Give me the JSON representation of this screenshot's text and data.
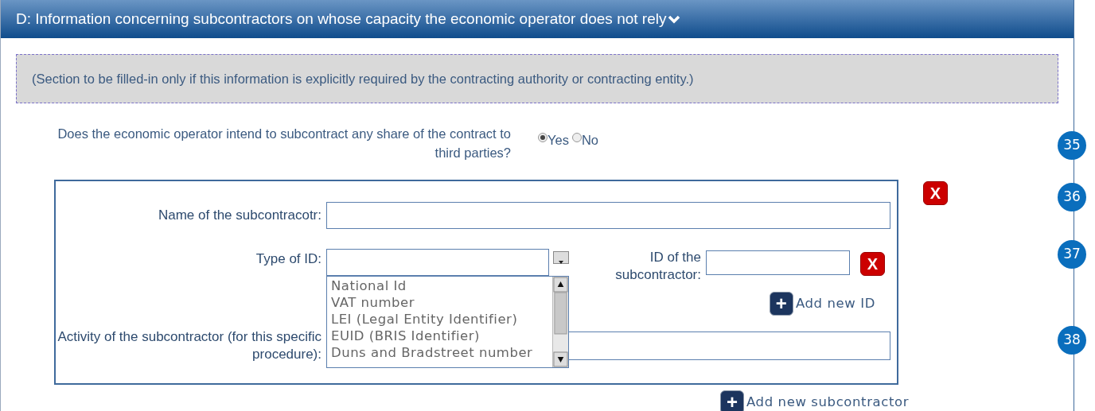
{
  "section": {
    "title": "D: Information concerning subcontractors on whose capacity the economic operator does not rely",
    "expanded": true
  },
  "notice": "(Section to be filled-in only if this information is explicitly required by the contracting authority or contracting entity.)",
  "question": {
    "label": "Does the economic operator intend to subcontract any share of the contract to third parties?",
    "options": [
      {
        "label": "Yes",
        "selected": true
      },
      {
        "label": "No",
        "selected": false
      }
    ]
  },
  "subcontractor": {
    "remove": "X",
    "name_label": "Name of the subcontracotr:",
    "type_label": "Type of ID:",
    "type_expanded": true,
    "type_options": [
      "National Id",
      "VAT number",
      "LEI (Legal Entity Identifier)",
      "EUID (BRIS Identifier)",
      "Duns and Bradstreet number"
    ],
    "id_label": "ID of the subcontractor:",
    "id_remove": "X",
    "add_id": {
      "icon": "+",
      "label": "Add new ID"
    },
    "activity_label": "Activity of the subcontractor (for this specific procedure):"
  },
  "add_subcontractor": {
    "icon": "+",
    "label": "Add new subcontractor"
  },
  "markers": [
    "35",
    "36",
    "37",
    "38"
  ]
}
